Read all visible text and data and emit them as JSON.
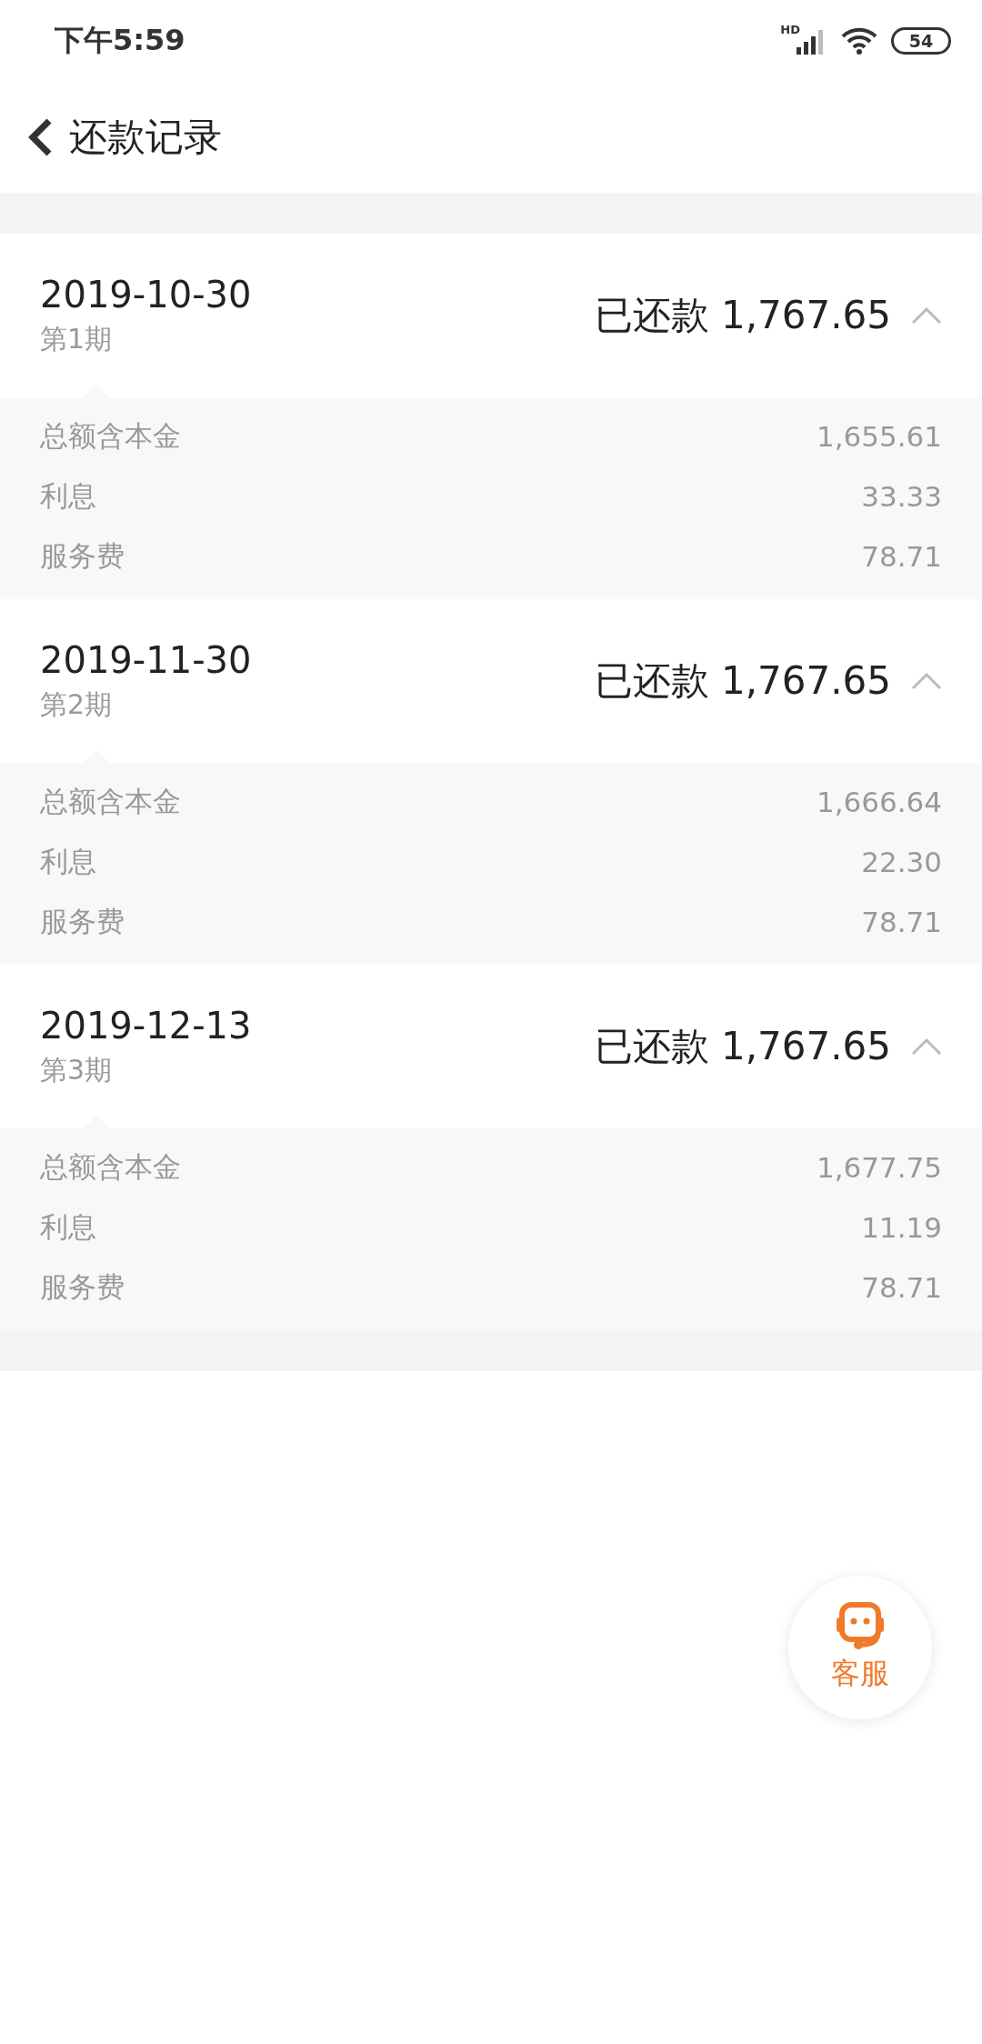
{
  "status_bar": {
    "time": "下午5:59",
    "signal_label": "HD",
    "battery": "54"
  },
  "header": {
    "title": "还款记录"
  },
  "records": [
    {
      "date": "2019-10-30",
      "period": "第1期",
      "amount": "已还款 1,767.65",
      "expanded": true,
      "details": [
        {
          "label": "总额含本金",
          "value": "1,655.61"
        },
        {
          "label": "利息",
          "value": "33.33"
        },
        {
          "label": "服务费",
          "value": "78.71"
        }
      ]
    },
    {
      "date": "2019-11-30",
      "period": "第2期",
      "amount": "已还款 1,767.65",
      "expanded": true,
      "details": [
        {
          "label": "总额含本金",
          "value": "1,666.64"
        },
        {
          "label": "利息",
          "value": "22.30"
        },
        {
          "label": "服务费",
          "value": "78.71"
        }
      ]
    },
    {
      "date": "2019-12-13",
      "period": "第3期",
      "amount": "已还款 1,767.65",
      "expanded": true,
      "details": [
        {
          "label": "总额含本金",
          "value": "1,677.75"
        },
        {
          "label": "利息",
          "value": "11.19"
        },
        {
          "label": "服务费",
          "value": "78.71"
        }
      ]
    }
  ],
  "service_button": {
    "label": "客服"
  }
}
